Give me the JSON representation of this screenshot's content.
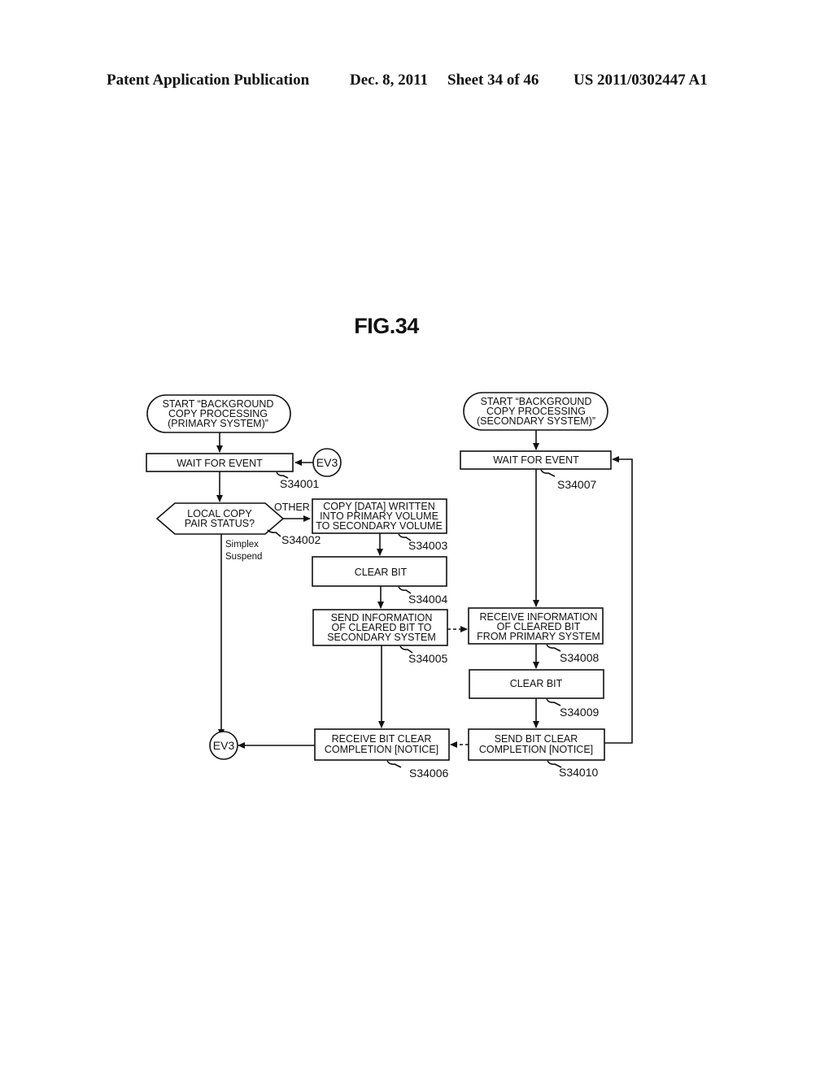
{
  "header": {
    "publication": "Patent Application Publication",
    "date": "Dec. 8, 2011",
    "sheet": "Sheet 34 of 46",
    "number": "US 2011/0302447 A1"
  },
  "figure": {
    "title": "FIG.34"
  },
  "primary": {
    "start": [
      "START “BACKGROUND",
      "COPY PROCESSING",
      "(PRIMARY SYSTEM)”"
    ],
    "wait": {
      "text": "WAIT FOR EVENT",
      "step": "S34001"
    },
    "connector_in": "EV3",
    "decision": {
      "text": [
        "LOCAL COPY",
        "PAIR STATUS?"
      ],
      "step": "S34002",
      "branch_other": "OTHER",
      "branch_down": [
        "Simplex",
        "Suspend"
      ]
    },
    "copy": {
      "text": [
        "COPY [DATA] WRITTEN",
        "INTO PRIMARY VOLUME",
        "TO SECONDARY VOLUME"
      ],
      "step": "S34003"
    },
    "clear": {
      "text": "CLEAR BIT",
      "step": "S34004"
    },
    "send_info": {
      "text": [
        "SEND INFORMATION",
        "OF CLEARED BIT TO",
        "SECONDARY SYSTEM"
      ],
      "step": "S34005"
    },
    "receive_done": {
      "text": [
        "RECEIVE BIT CLEAR",
        "COMPLETION [NOTICE]"
      ],
      "step": "S34006"
    },
    "connector_out": "EV3"
  },
  "secondary": {
    "start": [
      "START “BACKGROUND",
      "COPY PROCESSING",
      "(SECONDARY SYSTEM)”"
    ],
    "wait": {
      "text": "WAIT FOR EVENT",
      "step": "S34007"
    },
    "receive_info": {
      "text": [
        "RECEIVE INFORMATION",
        "OF CLEARED BIT",
        "FROM PRIMARY SYSTEM"
      ],
      "step": "S34008"
    },
    "clear": {
      "text": "CLEAR BIT",
      "step": "S34009"
    },
    "send_done": {
      "text": [
        "SEND BIT CLEAR",
        "COMPLETION [NOTICE]"
      ],
      "step": "S34010"
    }
  }
}
